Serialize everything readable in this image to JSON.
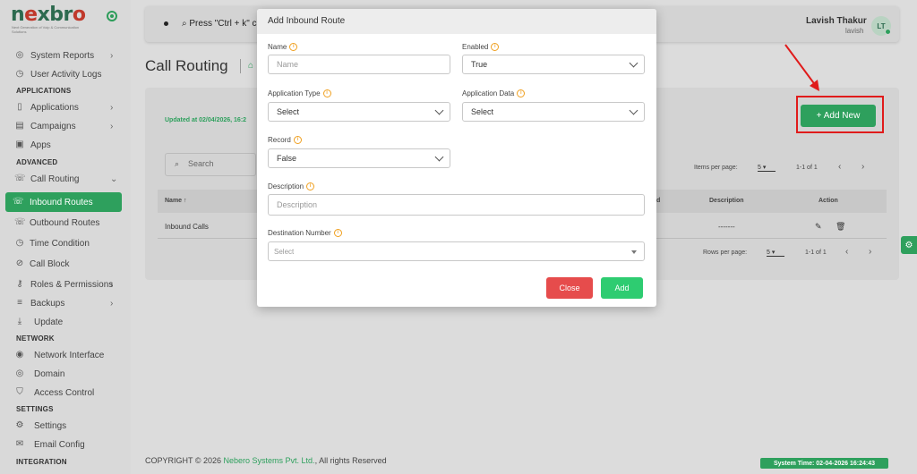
{
  "brand": {
    "logo_text": "nexbro",
    "logo_sub": "Next Generation of Voip & Communication Solutions"
  },
  "sidebar": {
    "items_top": [
      {
        "label": "System Reports",
        "icon": "globe-icon",
        "chevron": "›"
      },
      {
        "label": "User Activity Logs",
        "icon": "clock-icon"
      }
    ],
    "section_applications": "APPLICATIONS",
    "items_apps": [
      {
        "label": "Applications",
        "icon": "phone-icon",
        "chevron": "›"
      },
      {
        "label": "Campaigns",
        "icon": "document-icon",
        "chevron": "›"
      },
      {
        "label": "Apps",
        "icon": "app-icon"
      }
    ],
    "section_advanced": "ADVANCED",
    "items_advanced": [
      {
        "label": "Call Routing",
        "icon": "call-routing-icon",
        "chevron": "⌄"
      },
      {
        "label": "Inbound Routes",
        "icon": "inbound-icon"
      },
      {
        "label": "Outbound Routes",
        "icon": "outbound-icon"
      },
      {
        "label": "Time Condition",
        "icon": "clock-icon"
      },
      {
        "label": "Call Block",
        "icon": "block-icon"
      },
      {
        "label": "Roles & Permissions",
        "icon": "key-icon",
        "chevron": "›"
      },
      {
        "label": "Backups",
        "icon": "database-icon",
        "chevron": "›"
      },
      {
        "label": "Update",
        "icon": "download-icon"
      }
    ],
    "section_network": "NETWORK",
    "items_network": [
      {
        "label": "Network Interface",
        "icon": "wifi-icon"
      },
      {
        "label": "Domain",
        "icon": "globe-icon"
      },
      {
        "label": "Access Control",
        "icon": "shield-icon"
      }
    ],
    "section_settings": "SETTINGS",
    "items_settings": [
      {
        "label": "Settings",
        "icon": "gear-icon"
      },
      {
        "label": "Email Config",
        "icon": "mail-icon"
      }
    ],
    "section_integration": "INTEGRATION"
  },
  "topbar": {
    "search_hint": "Press \"Ctrl + k\" c",
    "user_name": "Lavish Thakur",
    "user_sub": "lavish",
    "avatar_initials": "LT"
  },
  "page": {
    "title": "Call Routing",
    "updated": "Updated at 02/04/2026, 16:2",
    "add_new": "+ Add New",
    "search_placeholder": "Search"
  },
  "table": {
    "items_per_page_label": "Items per page:",
    "items_per_page_value": "5",
    "range": "1-1 of 1",
    "headers": {
      "name": "Name ↑",
      "d": "d",
      "description": "Description",
      "action": "Action"
    },
    "rows": [
      {
        "name": "Inbound Calls",
        "description": "-------"
      }
    ],
    "rows_per_page_label": "Rows per page:",
    "rows_per_page_value": "5",
    "rows_range": "1-1 of 1"
  },
  "footer": {
    "copyright_pre": "COPYRIGHT © 2026",
    "company": "Nebero Systems Pvt. Ltd.",
    "copyright_post": ", All rights Reserved",
    "system_time": "System Time: 02-04-2026 16:24:43"
  },
  "modal": {
    "title": "Add Inbound Route",
    "name_label": "Name",
    "name_placeholder": "Name",
    "enabled_label": "Enabled",
    "enabled_value": "True",
    "app_type_label": "Application Type",
    "app_type_value": "Select",
    "app_data_label": "Application Data",
    "app_data_value": "Select",
    "record_label": "Record",
    "record_value": "False",
    "description_label": "Description",
    "description_placeholder": "Description",
    "dest_label": "Destination Number",
    "dest_value": "Select",
    "close_label": "Close",
    "add_label": "Add"
  },
  "colors": {
    "accent": "#2ea05d",
    "danger": "#e64c4c",
    "add": "#2ecc71",
    "annotation": "#e01b1b"
  }
}
